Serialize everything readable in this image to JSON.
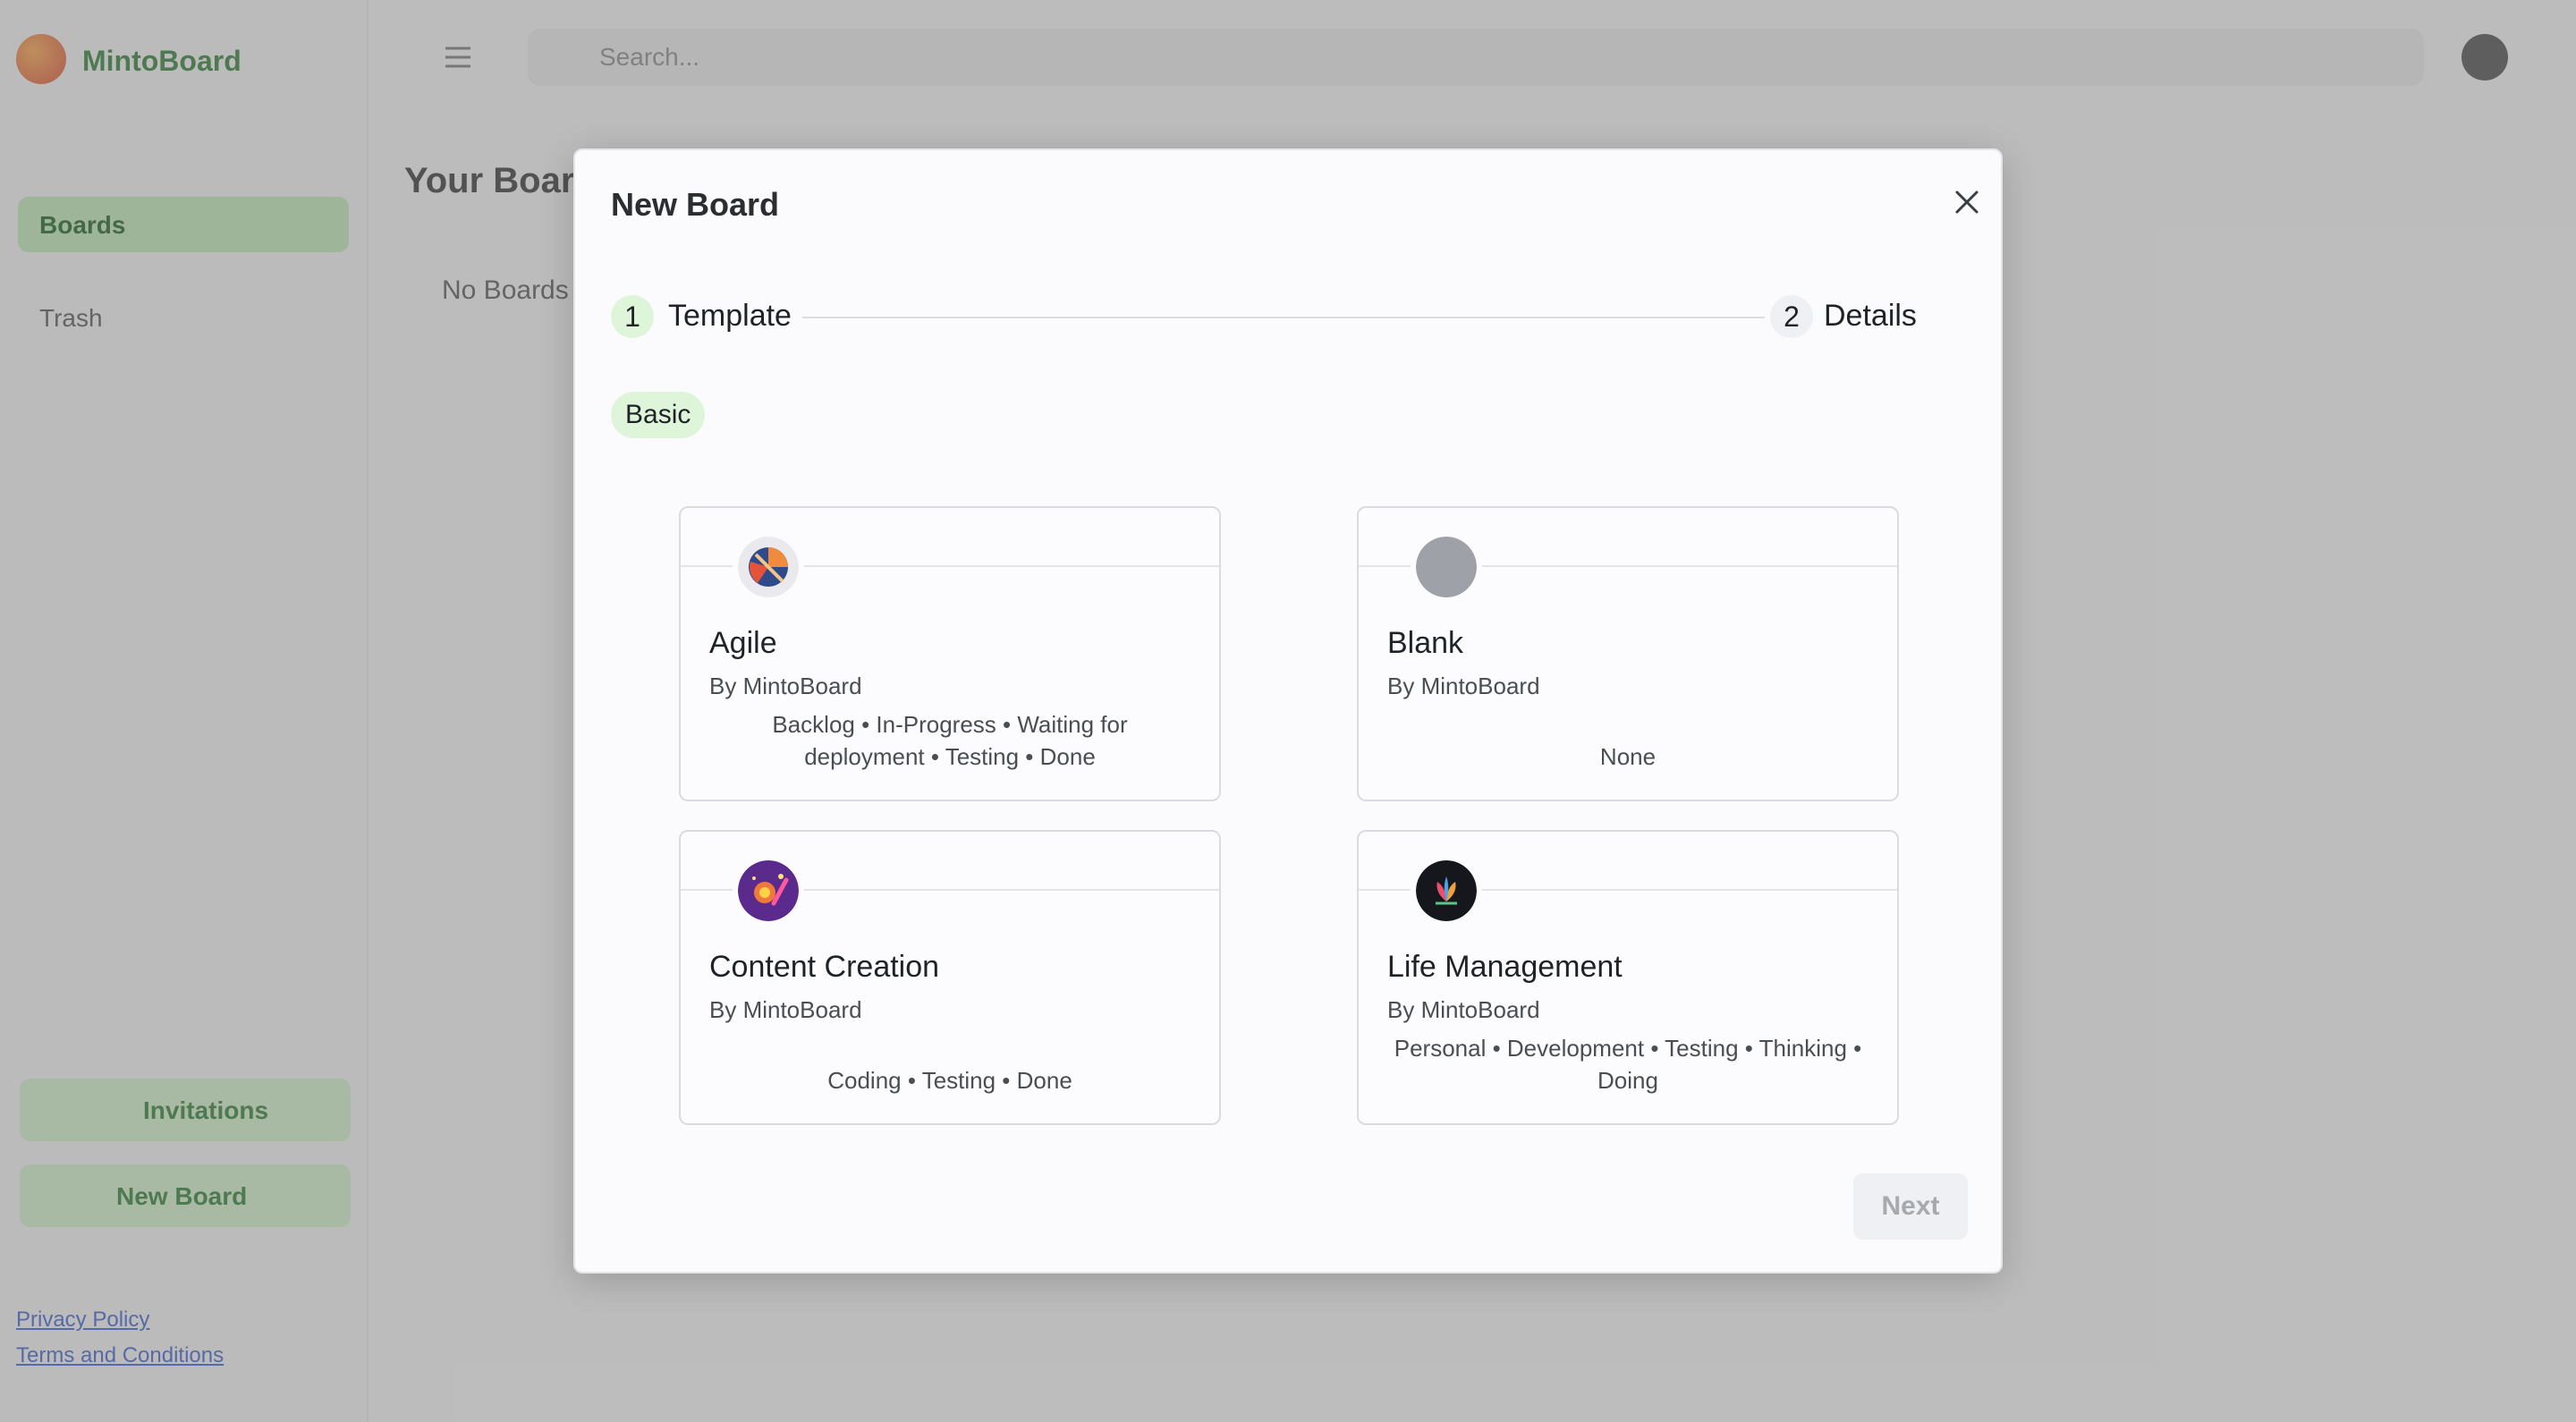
{
  "background": {
    "logo_text": "MintoBoard",
    "nav_active": "Boards",
    "nav_item": "Trash",
    "side_buttons": [
      "Invitations",
      "New Board"
    ],
    "side_links": [
      "Privacy Policy",
      "Terms and Conditions"
    ],
    "search_placeholder": "Search...",
    "page_title": "Your Boards",
    "page_sub": "No Boards"
  },
  "modal": {
    "title": "New Board",
    "steps": [
      {
        "number": "1",
        "label": "Template"
      },
      {
        "number": "2",
        "label": "Details"
      }
    ],
    "category": "Basic",
    "templates": [
      {
        "name": "Agile",
        "author": "By MintoBoard",
        "columns": "Backlog • In-Progress • Waiting for deployment • Testing • Done",
        "icon": "agile-logo-icon"
      },
      {
        "name": "Blank",
        "author": "By MintoBoard",
        "columns": "None",
        "icon": "blank-circle-icon"
      },
      {
        "name": "Content Creation",
        "author": "By MintoBoard",
        "columns": "Coding • Testing • Done",
        "icon": "content-creation-logo-icon"
      },
      {
        "name": "Life Management",
        "author": "By MintoBoard",
        "columns": "Personal • Development • Testing • Thinking • Doing",
        "icon": "life-management-logo-icon"
      }
    ],
    "next_label": "Next"
  },
  "colors": {
    "accent_green": "#dff5da",
    "disabled_button": "#eef0f3"
  }
}
